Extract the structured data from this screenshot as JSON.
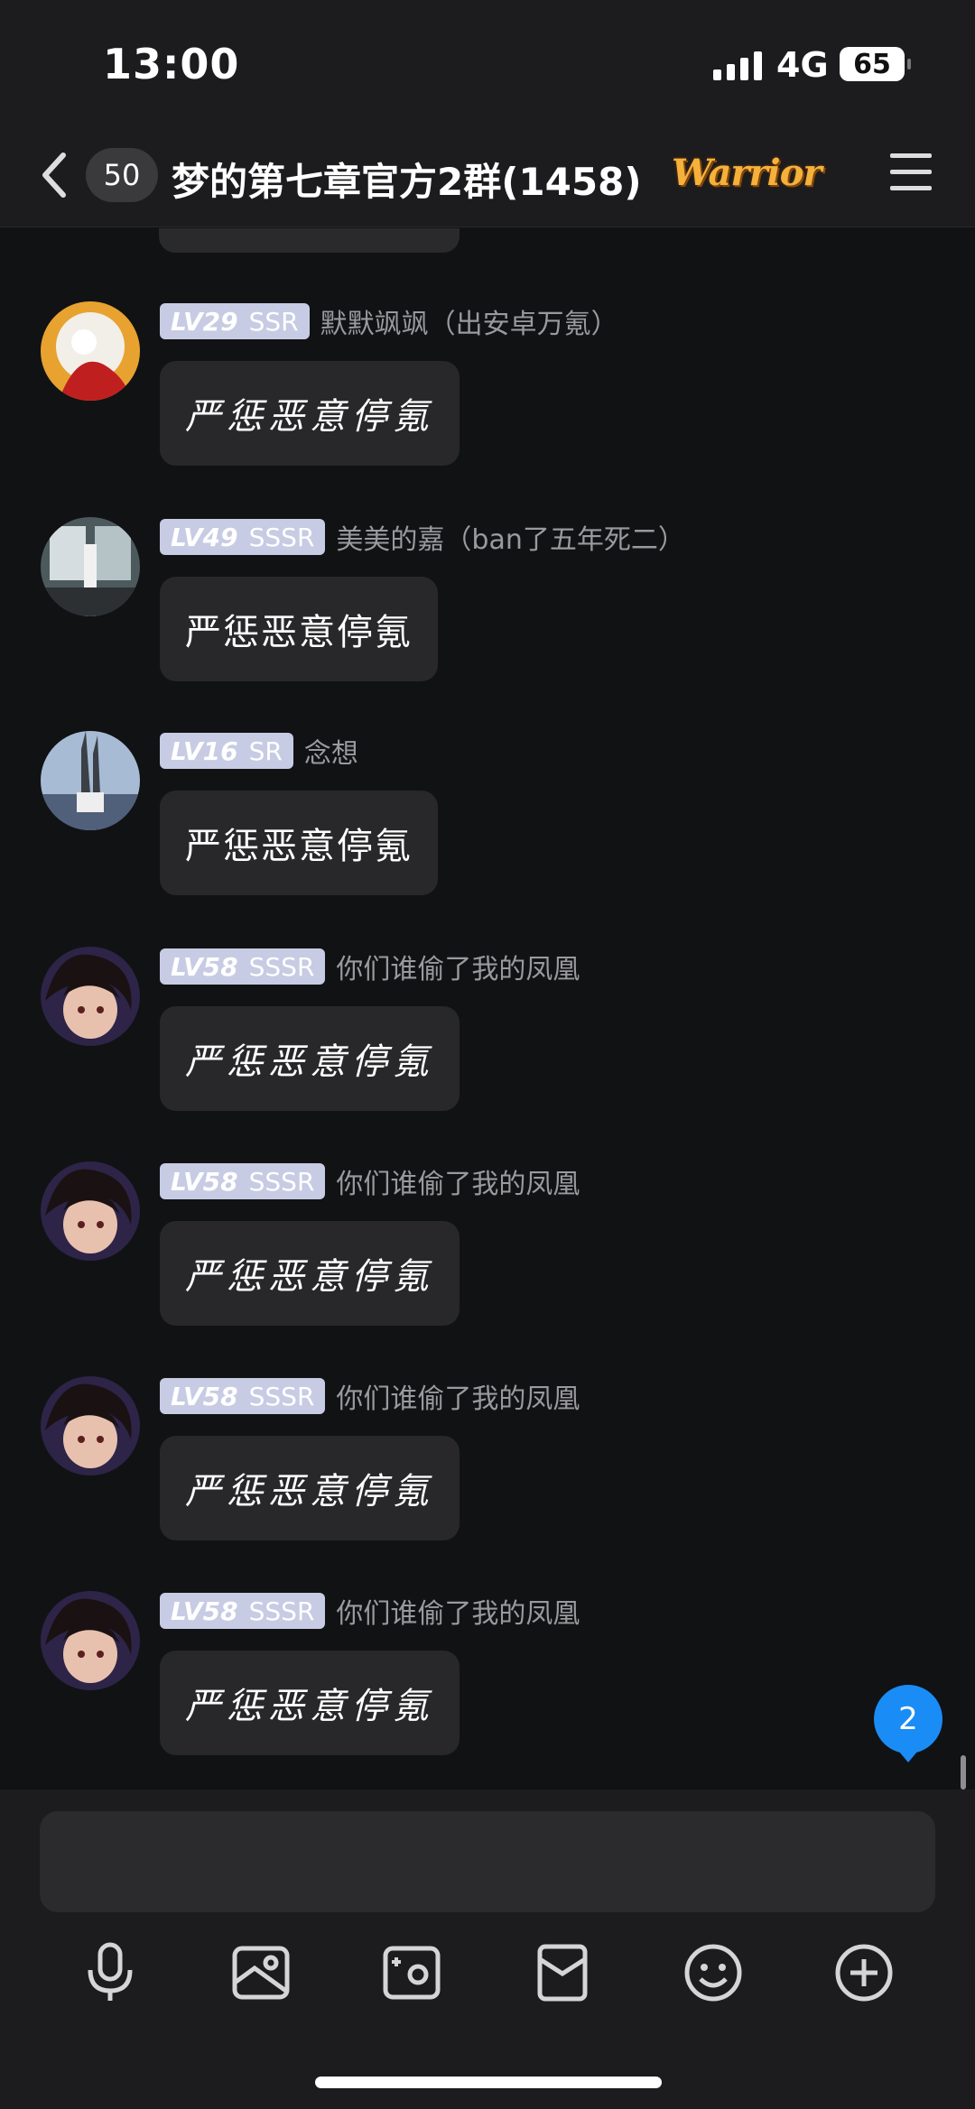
{
  "status": {
    "time": "13:00",
    "network": "4G",
    "battery": "65"
  },
  "header": {
    "unread": "50",
    "title": "梦的第七章官方2群(1458)",
    "badge": "Warrior"
  },
  "messages": [
    {
      "level": "LV29",
      "tier": "SSR",
      "name": "默默飒飒（出安卓万氪）",
      "text": "严惩恶意停氪",
      "style": "hand"
    },
    {
      "level": "LV49",
      "tier": "SSSR",
      "name": "美美的嘉（ban了五年死二）",
      "text": "严惩恶意停氪",
      "style": "plain"
    },
    {
      "level": "LV16",
      "tier": "SR",
      "name": "念想",
      "text": "严惩恶意停氪",
      "style": "plain"
    },
    {
      "level": "LV58",
      "tier": "SSSR",
      "name": "你们谁偷了我的凤凰",
      "text": "严惩恶意停氪",
      "style": "hand"
    },
    {
      "level": "LV58",
      "tier": "SSSR",
      "name": "你们谁偷了我的凤凰",
      "text": "严惩恶意停氪",
      "style": "hand"
    },
    {
      "level": "LV58",
      "tier": "SSSR",
      "name": "你们谁偷了我的凤凰",
      "text": "严惩恶意停氪",
      "style": "hand"
    },
    {
      "level": "LV58",
      "tier": "SSSR",
      "name": "你们谁偷了我的凤凰",
      "text": "严惩恶意停氪",
      "style": "hand"
    }
  ],
  "new_message_count": "2",
  "toolbar": [
    "microphone-icon",
    "image-icon",
    "camera-icon",
    "red-packet-icon",
    "emoji-icon",
    "plus-icon"
  ]
}
